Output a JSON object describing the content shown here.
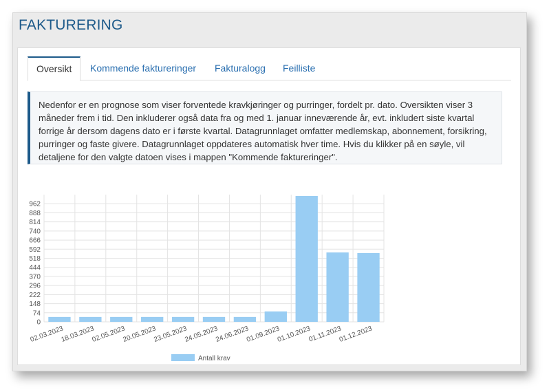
{
  "page": {
    "title": "FAKTURERING"
  },
  "tabs": [
    {
      "label": "Oversikt",
      "active": true
    },
    {
      "label": "Kommende faktureringer",
      "active": false
    },
    {
      "label": "Fakturalogg",
      "active": false
    },
    {
      "label": "Feilliste",
      "active": false
    }
  ],
  "info_text": "Nedenfor er en prognose som viser forventede kravkjøringer og purringer, fordelt pr. dato. Oversikten viser 3 måneder frem i tid. Den inkluderer også data fra og med 1. januar inneværende år, evt. inkludert siste kvartal forrige år dersom dagens dato er i første kvartal. Datagrunnlaget omfatter medlemskap, abonnement, forsikring, purringer og faste givere. Datagrunnlaget oppdateres automatisk hver time. Hvis du klikker på en søyle, vil detaljene for den valgte datoen vises i mappen \"Kommende faktureringer\".",
  "colors": {
    "accent": "#1d5a8a",
    "bar": "#99cdf3",
    "link": "#2a6fb0"
  },
  "chart_data": {
    "type": "bar",
    "categories": [
      "02.03.2023",
      "18.03.2023",
      "02.05.2023",
      "20.05.2023",
      "23.05.2023",
      "24.05.2023",
      "24.06.2023",
      "01.09.2023",
      "01.10.2023",
      "01.11.2023",
      "01.12.2023"
    ],
    "series": [
      {
        "name": "Antall krav",
        "values": [
          40,
          40,
          40,
          40,
          40,
          40,
          40,
          85,
          1025,
          565,
          560
        ]
      }
    ],
    "yticks": [
      0,
      74,
      148,
      222,
      296,
      370,
      444,
      518,
      592,
      666,
      740,
      814,
      888,
      962
    ],
    "ylim": [
      0,
      1036
    ],
    "grid": true,
    "legend": "bottom"
  }
}
